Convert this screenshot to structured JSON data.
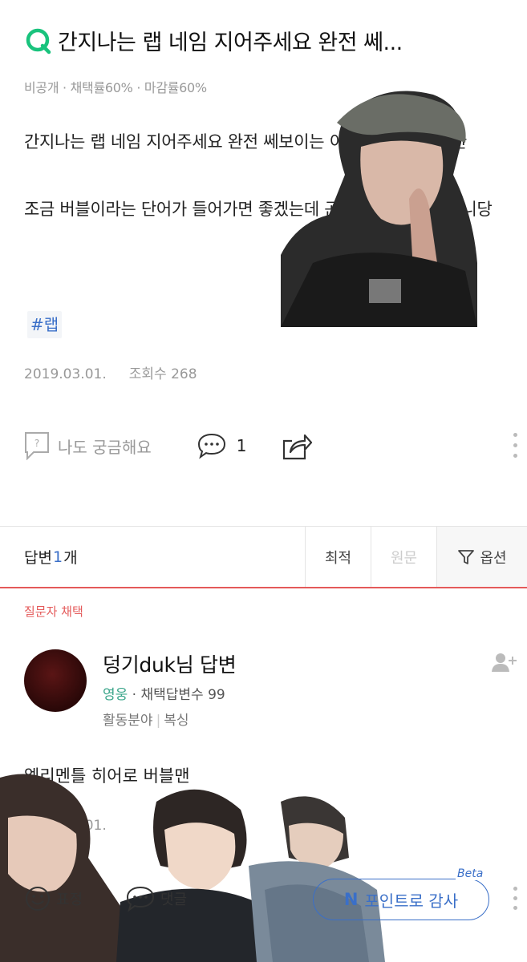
{
  "question": {
    "title": "간지나는 랩 네임 지어주세요 완전 쎄...",
    "meta": "비공개 · 채택률60% · 마감률60%",
    "paragraphs": [
      "간지나는 랩 네임 지어주세요 완전 쎄보이는 이름 듣고 다 쫄만한",
      "조금 버블이라는 단어가 들어가면 좋겠는데 곤이 안 들어가도 됩니당"
    ],
    "tag": "#랩",
    "date": "2019.03.01.",
    "views": "조회수 268",
    "curious_label": "나도 궁금해요",
    "comment_count": "1"
  },
  "answers_bar": {
    "label_prefix": "답변 ",
    "count": "1",
    "label_suffix": "개",
    "sort_latest": "최적",
    "sort_original": "원문",
    "options": "옵션"
  },
  "answer": {
    "chosen_label": "질문자 채택",
    "name": "덩기duk님 답변",
    "level": "영웅",
    "level_rest": " · 채택답변수 99",
    "field_label": "활동분야",
    "field_value": "복싱",
    "text": "엘리멘틀 히어로 버블맨",
    "date": "2019.03.01.",
    "emoji_label": "표정",
    "comment_label": "댓글",
    "thanks_label": "포인트로 감사",
    "n_logo": "N",
    "beta": "Beta"
  },
  "colors": {
    "accent_green": "#19c37d",
    "accent_blue": "#3a6fc8",
    "accent_red": "#e45a5a"
  },
  "icons": [
    "q-logo-icon",
    "question-box-icon",
    "comment-icon",
    "share-icon",
    "more-vertical-icon",
    "filter-icon",
    "add-friend-icon",
    "smile-icon",
    "comment-bubble-icon"
  ]
}
